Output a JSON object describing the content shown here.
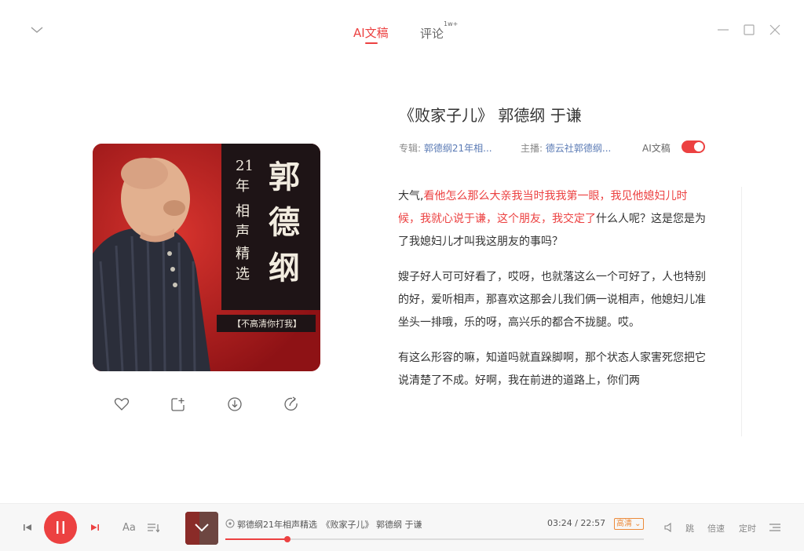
{
  "tabs": [
    {
      "label": "AI文稿",
      "active": true
    },
    {
      "label": "评论",
      "badge": "1w+",
      "active": false
    }
  ],
  "cover": {
    "vertical_title": "郭德纲",
    "subtitle_chars": [
      "21年",
      "相声",
      "精选"
    ],
    "banner": "【不高清你打我】"
  },
  "episode": {
    "title": "《败家子儿》 郭德纲 于谦",
    "album_label": "专辑:",
    "album_value": "郭德纲21年相...",
    "host_label": "主播:",
    "host_value": "德云社郭德纲...",
    "ai_label": "AI文稿",
    "ai_enabled": true
  },
  "transcript": [
    {
      "segments": [
        {
          "text": "大气,",
          "highlight": false
        },
        {
          "text": "看他怎么那么大亲我当时我我第一眼，我见他媳妇儿时候，我就心说于谦，这个朋友，我交定了",
          "highlight": true
        },
        {
          "text": "什么人呢？这是您是为了我媳妇儿才叫我这朋友的事吗？",
          "highlight": false
        }
      ]
    },
    {
      "segments": [
        {
          "text": "嫂子好人可可好看了，哎呀，也就落这么一个可好了，人也特别的好，爱听相声，那喜欢这那会儿我们俩一说相声，他媳妇儿准坐头一排哦，乐的呀，高兴乐的都合不拢腿。哎。",
          "highlight": false
        }
      ]
    },
    {
      "segments": [
        {
          "text": "有这么形容的嘛，知道吗就直跺脚啊，那个状态人家害死您把它说清楚了不成。好啊，我在前进的道路上，你们两",
          "highlight": false
        }
      ]
    }
  ],
  "player": {
    "now_playing": "郭德纲21年相声精选　《败家子儿》 郭德纲 于谦",
    "current_time": "03:24",
    "total_time": "22:57",
    "time_sep": " / ",
    "quality": "高清",
    "progress": 0.148,
    "font_label": "Aa",
    "skip_label": "跳",
    "speed_label": "倍速",
    "timer_label": "定时",
    "accent": "#ec4141"
  }
}
